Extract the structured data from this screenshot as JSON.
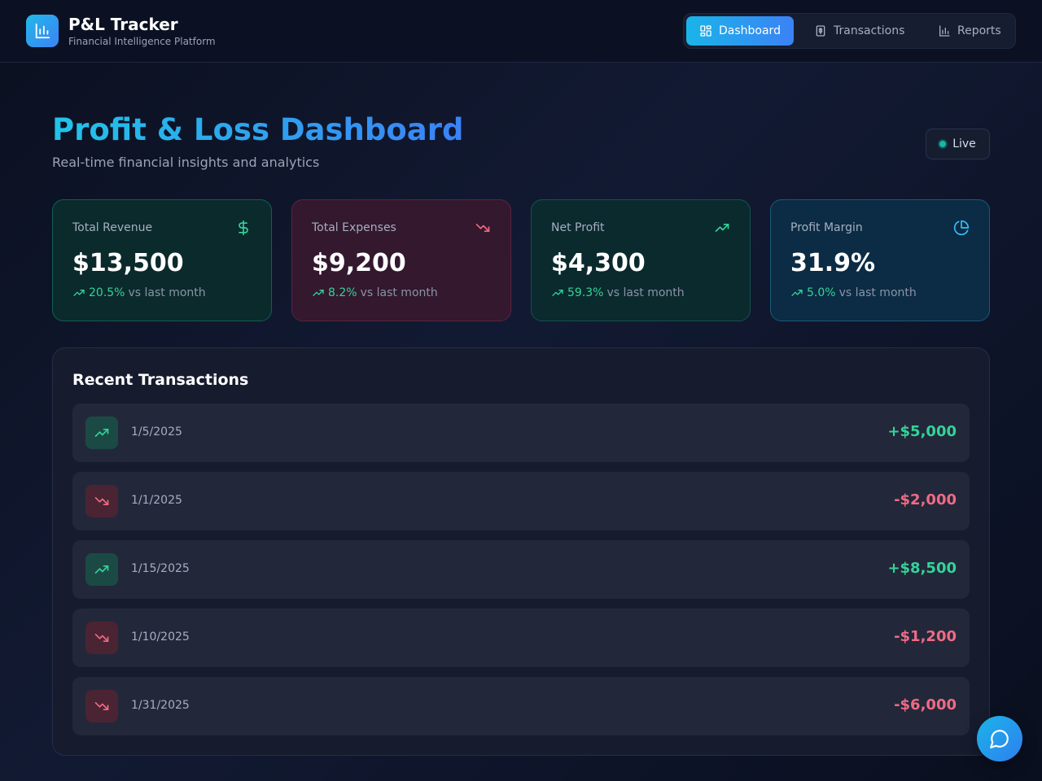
{
  "brand": {
    "title": "P&L Tracker",
    "subtitle": "Financial Intelligence Platform",
    "icon": "bar-chart-icon"
  },
  "nav": {
    "items": [
      {
        "label": "Dashboard",
        "icon": "grid-icon",
        "active": true
      },
      {
        "label": "Transactions",
        "icon": "receipt-icon",
        "active": false
      },
      {
        "label": "Reports",
        "icon": "bar-chart-icon",
        "active": false
      }
    ]
  },
  "page": {
    "title": "Profit & Loss Dashboard",
    "subtitle": "Real-time financial insights and analytics",
    "live_label": "Live"
  },
  "stats": [
    {
      "label": "Total Revenue",
      "value": "$13,500",
      "delta": "20.5%",
      "delta_suffix": "vs last month",
      "icon": "dollar-icon",
      "icon_color": "#34d399"
    },
    {
      "label": "Total Expenses",
      "value": "$9,200",
      "delta": "8.2%",
      "delta_suffix": "vs last month",
      "icon": "trending-down-icon",
      "icon_color": "#f06a85"
    },
    {
      "label": "Net Profit",
      "value": "$4,300",
      "delta": "59.3%",
      "delta_suffix": "vs last month",
      "icon": "trending-up-icon",
      "icon_color": "#34d399"
    },
    {
      "label": "Profit Margin",
      "value": "31.9%",
      "delta": "5.0%",
      "delta_suffix": "vs last month",
      "icon": "pie-chart-icon",
      "icon_color": "#38bdf8"
    }
  ],
  "transactions": {
    "title": "Recent Transactions",
    "rows": [
      {
        "date": "1/5/2025",
        "amount": "+$5,000",
        "direction": "up"
      },
      {
        "date": "1/1/2025",
        "amount": "-$2,000",
        "direction": "down"
      },
      {
        "date": "1/15/2025",
        "amount": "+$8,500",
        "direction": "up"
      },
      {
        "date": "1/10/2025",
        "amount": "-$1,200",
        "direction": "down"
      },
      {
        "date": "1/31/2025",
        "amount": "-$6,000",
        "direction": "down"
      }
    ]
  },
  "chat": {
    "icon": "chat-bubble-icon"
  },
  "colors": {
    "accent": "#3b82f6",
    "positive": "#34d399",
    "negative": "#f06a85"
  }
}
